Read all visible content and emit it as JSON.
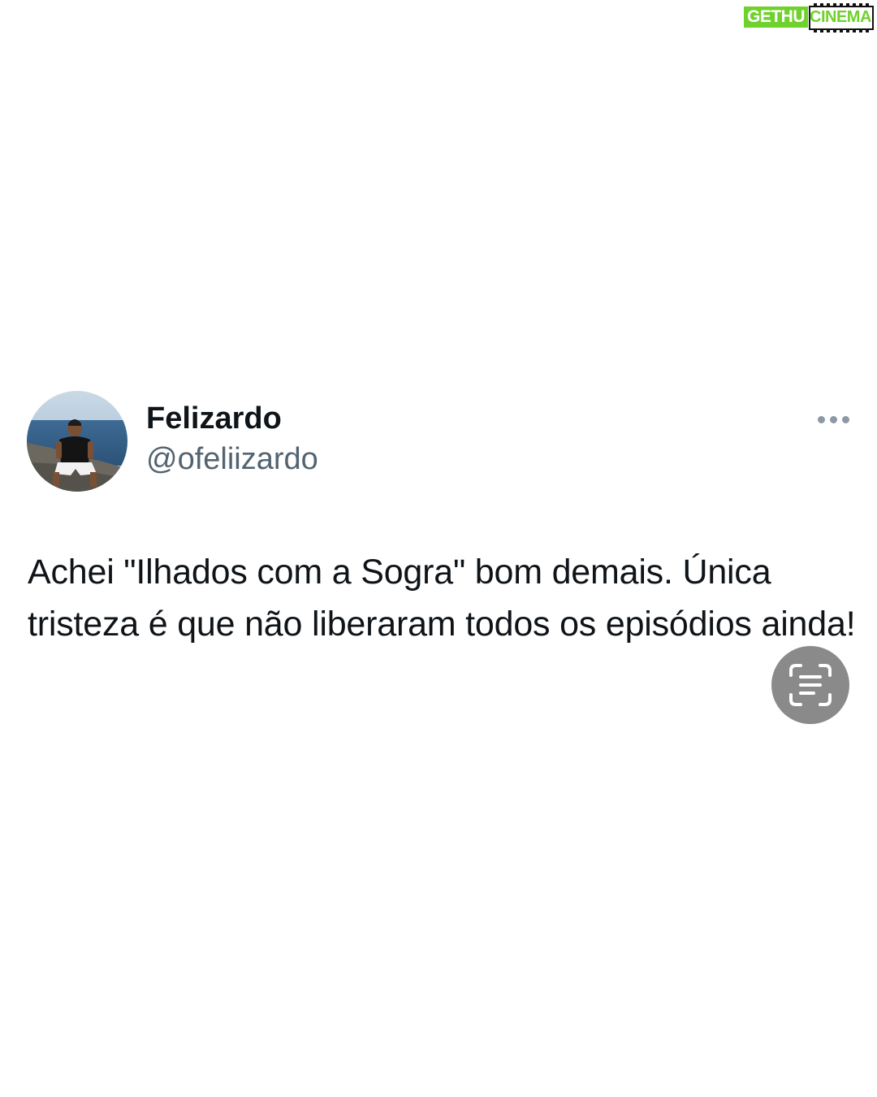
{
  "watermark": {
    "part1": "GETHU",
    "part2": "CINEMA"
  },
  "tweet": {
    "display_name": "Felizardo",
    "handle": "@ofeliizardo",
    "body": "Achei \"Ilhados com a Sogra\" bom demais. Única tristeza é que não liberaram todos os episódios ainda!"
  },
  "icons": {
    "more": "more-horizontal-icon",
    "scan": "live-text-scan-icon"
  },
  "colors": {
    "text_primary": "#0f1419",
    "text_secondary": "#536471",
    "brand_green": "#6fd12c",
    "scan_button": "#8a8a8a"
  }
}
